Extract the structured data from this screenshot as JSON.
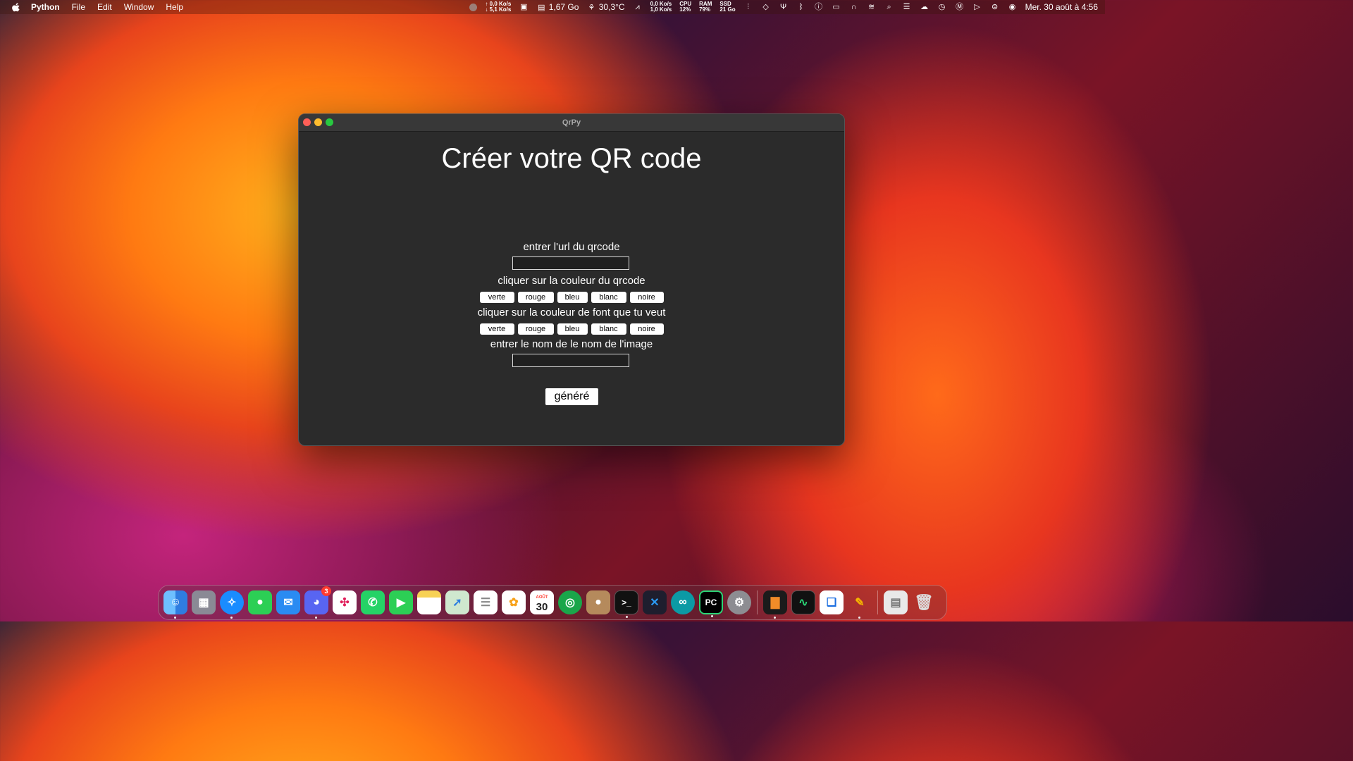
{
  "menubar": {
    "app_name": "Python",
    "menus": [
      "File",
      "Edit",
      "Window",
      "Help"
    ],
    "net_up": "↑ 0,0 Ko/s",
    "net_down": "↓ 5,1 Ko/s",
    "memory": "1,67 Go",
    "temperature": "30,3°C",
    "disk_read": "0,0 Ko/s",
    "disk_write": "1,0 Ko/s",
    "cpu_label": "CPU",
    "cpu_value": "12%",
    "ram_label": "RAM",
    "ram_value": "79%",
    "ssd_label": "SSD",
    "ssd_value": "21 Go",
    "clock": "Mer. 30 août à 4:56"
  },
  "window": {
    "title": "QrPy",
    "heading": "Créer votre QR code",
    "url_label": "entrer l'url du qrcode",
    "url_value": "",
    "qr_color_label": "cliquer sur la couleur du qrcode",
    "qr_colors": [
      "verte",
      "rouge",
      "bleu",
      "blanc",
      "noire"
    ],
    "bg_color_label": "cliquer sur la couleur de font que tu veut",
    "bg_colors": [
      "verte",
      "rouge",
      "bleu",
      "blanc",
      "noire"
    ],
    "name_label": "entrer le nom de le nom de l'image",
    "name_value": "",
    "generate_label": "généré"
  },
  "dock": {
    "calendar_month": "AOÛT",
    "calendar_day": "30",
    "discord_badge": "3",
    "pycharm_text": "PC"
  }
}
